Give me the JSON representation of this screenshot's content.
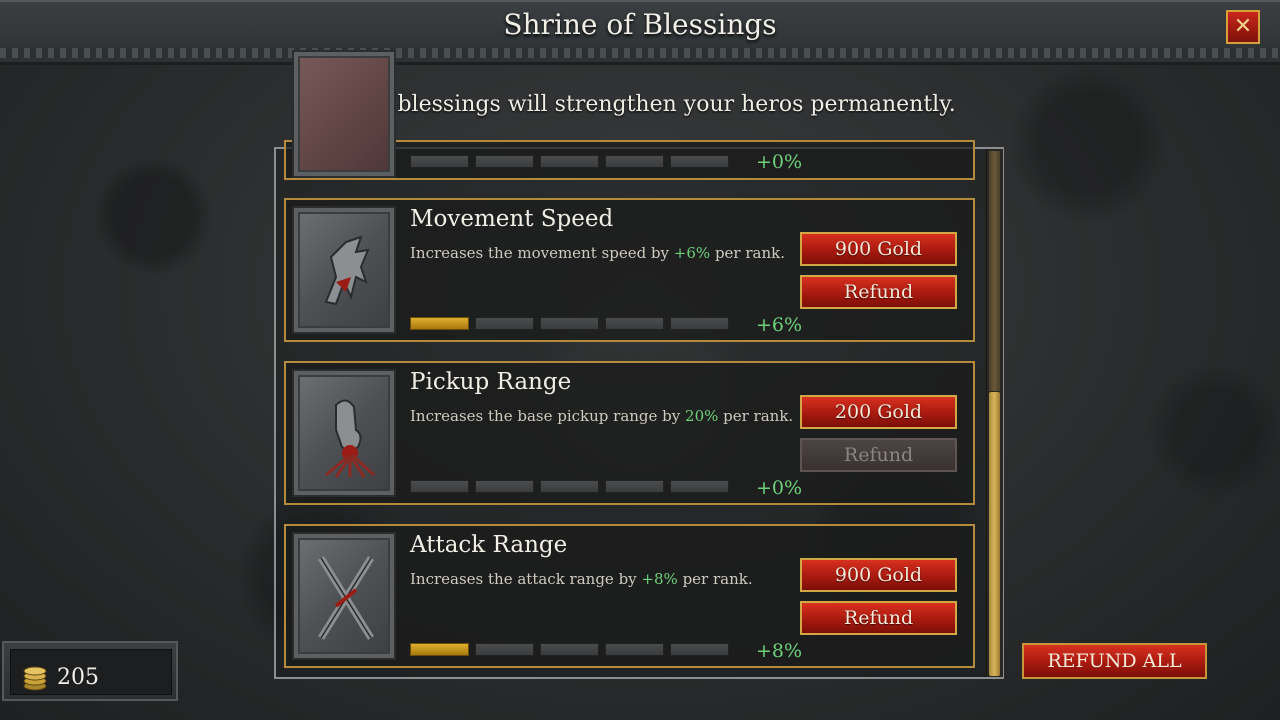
{
  "header": {
    "title": "Shrine of Blessings",
    "close_icon": "close-icon"
  },
  "subtitle": "These blessings will strengthen your heros permanently.",
  "partial_row": {
    "filled_ranks": 0,
    "total_ranks": 5,
    "bonus": "+0%"
  },
  "blessings": [
    {
      "title": "Movement Speed",
      "desc_pre": "Increases the movement speed by ",
      "desc_pct": "+6%",
      "desc_post": " per rank.",
      "buy_label": "900 Gold",
      "refund_label": "Refund",
      "refund_enabled": true,
      "filled_ranks": 1,
      "total_ranks": 5,
      "bonus": "+6%",
      "icon": "pegasus-icon"
    },
    {
      "title": "Pickup Range",
      "desc_pre": "Increases the base pickup range by ",
      "desc_pct": "20%",
      "desc_post": " per rank.",
      "buy_label": "200 Gold",
      "refund_label": "Refund",
      "refund_enabled": false,
      "filled_ranks": 0,
      "total_ranks": 5,
      "bonus": "+0%",
      "icon": "hand-icon"
    },
    {
      "title": "Attack Range",
      "desc_pre": "Increases the attack range by ",
      "desc_pct": "+8%",
      "desc_post": " per rank.",
      "buy_label": "900 Gold",
      "refund_label": "Refund",
      "refund_enabled": true,
      "filled_ranks": 1,
      "total_ranks": 5,
      "bonus": "+8%",
      "icon": "crossed-swords-icon"
    }
  ],
  "refund_all_label": "REFUND ALL",
  "gold": {
    "amount": "205",
    "icon": "gold-coins-icon"
  },
  "colors": {
    "accent_gold": "#b28c3a",
    "button_red": "#a81a10",
    "bonus_green": "#6fd07a"
  }
}
